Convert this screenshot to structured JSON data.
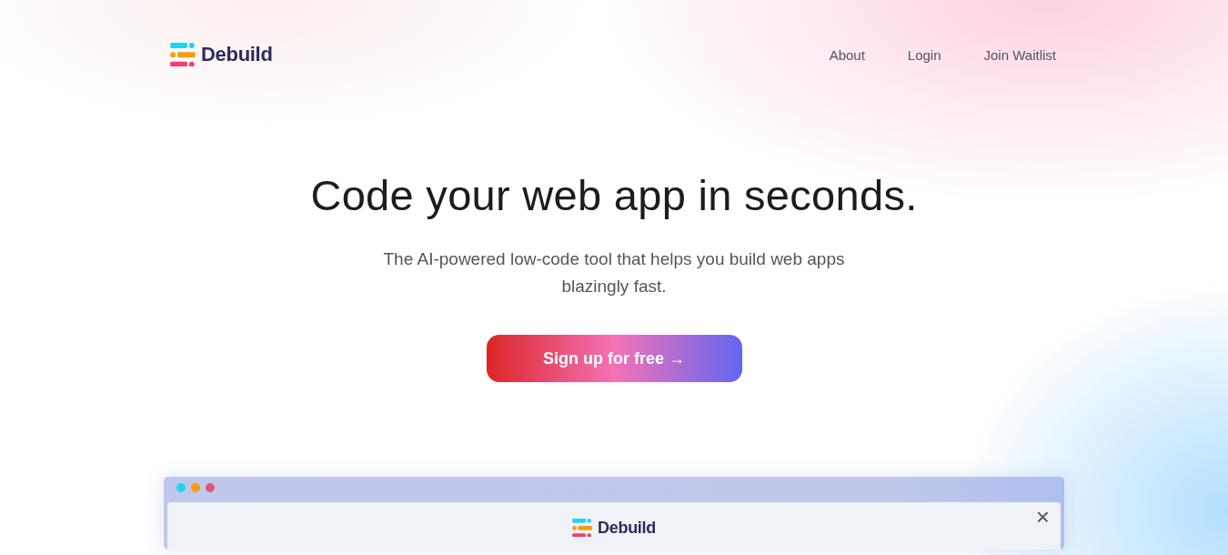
{
  "brand": {
    "name": "Debuild"
  },
  "nav": [
    {
      "label": "About"
    },
    {
      "label": "Login"
    },
    {
      "label": "Join Waitlist"
    }
  ],
  "hero": {
    "title": "Code your web app in seconds.",
    "subtitle": "The AI-powered low-code tool that helps you build web apps blazingly fast.",
    "cta": "Sign up for free →"
  },
  "preview": {
    "window_dots": [
      {
        "color": "#22d3ee"
      },
      {
        "color": "#f59e0b"
      },
      {
        "color": "#e0557a"
      }
    ],
    "brand": "Debuild",
    "close": "×"
  }
}
